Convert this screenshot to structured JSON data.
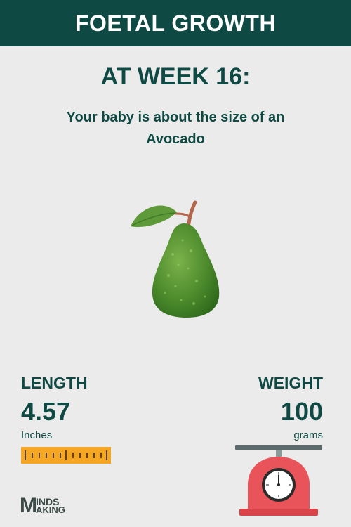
{
  "header": {
    "title": "FOETAL GROWTH"
  },
  "week": {
    "heading": "AT WEEK 16:"
  },
  "size": {
    "text": "Your baby is about the size of an Avocado"
  },
  "fruit": {
    "icon": "avocado-icon"
  },
  "length": {
    "label": "LENGTH",
    "value": "4.57",
    "unit": "Inches",
    "icon": "measuring-tape-icon"
  },
  "weight": {
    "label": "WEIGHT",
    "value": "100",
    "unit": "grams",
    "icon": "weighing-scale-icon"
  },
  "logo": {
    "letter": "M",
    "line1": "INDS",
    "line2": "AKING"
  },
  "colors": {
    "brand": "#0e4a43",
    "background": "#ebebeb",
    "tape": "#f5a623",
    "scale": "#e8545a"
  }
}
